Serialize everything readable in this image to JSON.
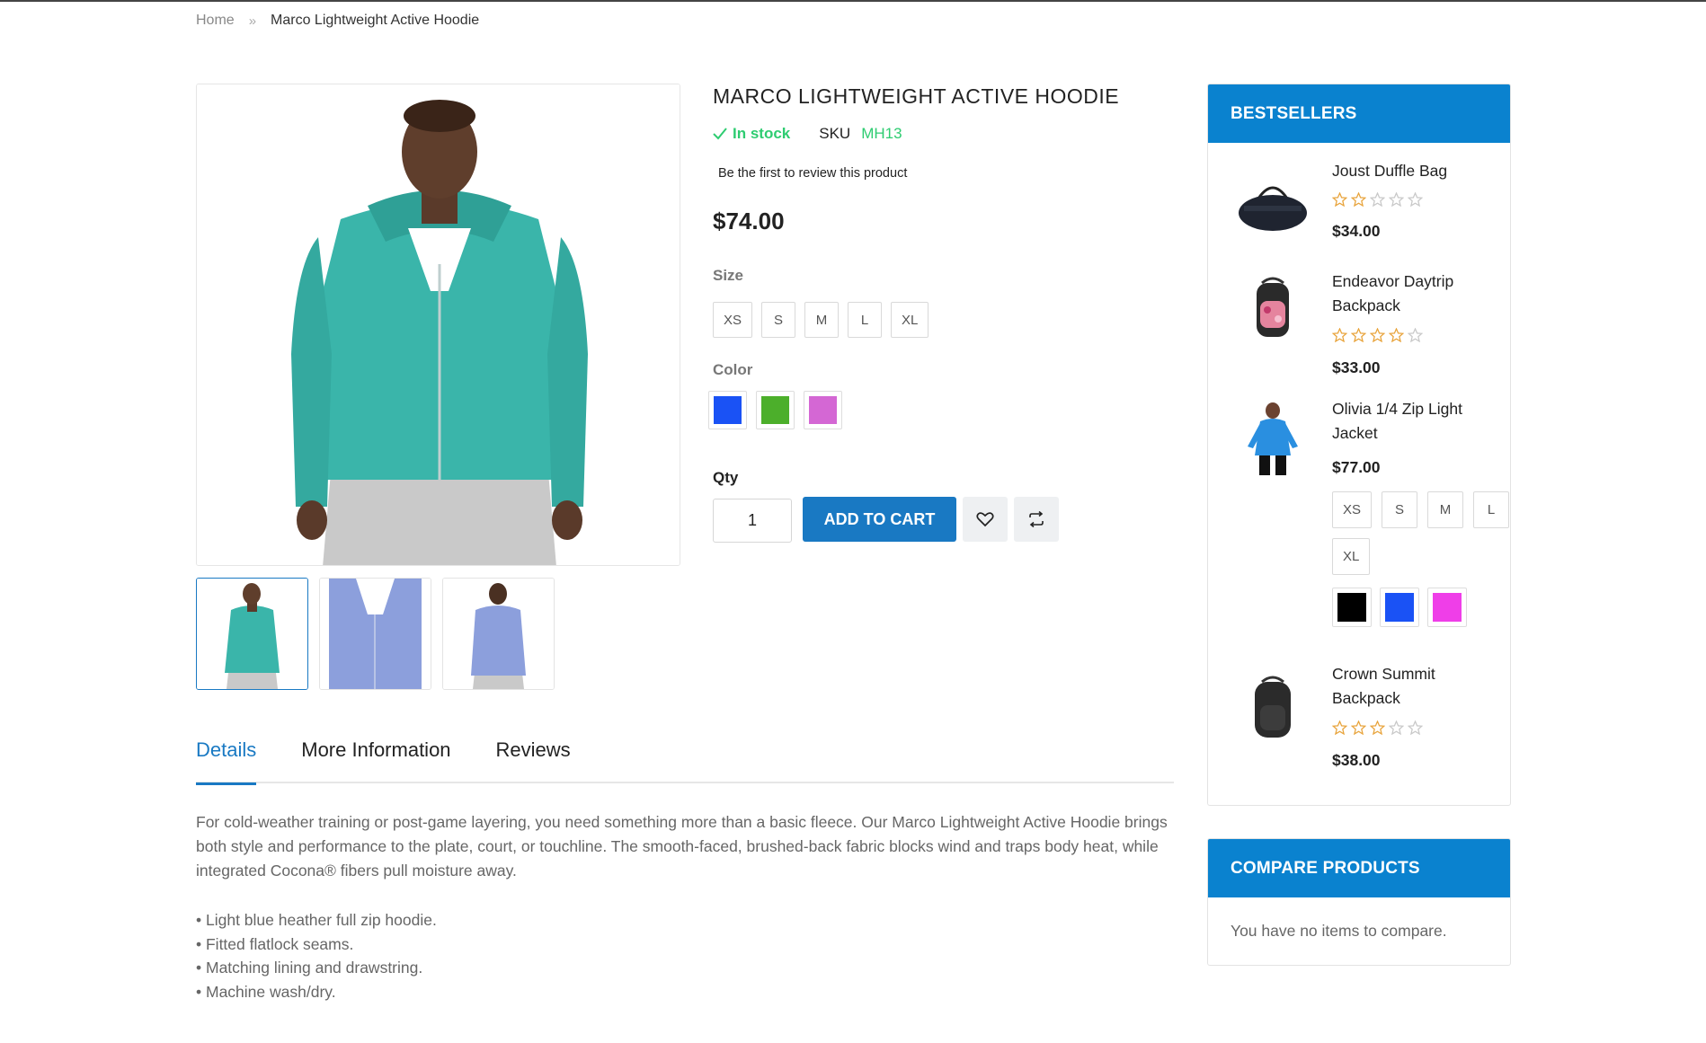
{
  "breadcrumb": {
    "home": "Home",
    "separator": "»",
    "current": "Marco Lightweight Active Hoodie"
  },
  "product": {
    "title": "MARCO LIGHTWEIGHT ACTIVE HOODIE",
    "stock": "In stock",
    "sku_label": "SKU",
    "sku": "MH13",
    "review_link": "Be the first to review this product",
    "price": "$74.00",
    "size_label": "Size",
    "sizes": [
      "XS",
      "S",
      "M",
      "L",
      "XL"
    ],
    "color_label": "Color",
    "colors": [
      "#1a52f5",
      "#4caf2b",
      "#d467d4"
    ],
    "qty_label": "Qty",
    "qty_value": "1",
    "add_to_cart": "ADD TO CART",
    "image_colors": {
      "main": "#3ab5aa",
      "alt": "#8c9fdc"
    }
  },
  "tabs": [
    "Details",
    "More Information",
    "Reviews"
  ],
  "description": "For cold-weather training or post-game layering, you need something more than a basic fleece. Our Marco Lightweight Active Hoodie brings both style and performance to the plate, court, or touchline. The smooth-faced, brushed-back fabric blocks wind and traps body heat, while integrated Cocona® fibers pull moisture away.",
  "bullets": [
    "• Light blue heather full zip hoodie.",
    "• Fitted flatlock seams.",
    "• Matching lining and drawstring.",
    "• Machine wash/dry."
  ],
  "bestsellers": {
    "title": "BESTSELLERS",
    "items": [
      {
        "name": "Joust Duffle Bag",
        "rating": 2,
        "price": "$34.00"
      },
      {
        "name": "Endeavor Daytrip Backpack",
        "rating": 4,
        "price": "$33.00"
      },
      {
        "name": "Olivia 1/4 Zip Light Jacket",
        "price": "$77.00",
        "sizes": [
          "XS",
          "S",
          "M",
          "L",
          "XL"
        ],
        "colors": [
          "#000000",
          "#1a52f5",
          "#ef3ee8"
        ]
      },
      {
        "name": "Crown Summit Backpack",
        "rating": 3,
        "price": "$38.00"
      }
    ]
  },
  "compare": {
    "title": "COMPARE PRODUCTS",
    "text": "You have no items to compare."
  },
  "colors": {
    "accent": "#1979c3",
    "header_blue": "#0a82cf",
    "stock_green": "#2ecc71",
    "star": "#e8a33a"
  }
}
